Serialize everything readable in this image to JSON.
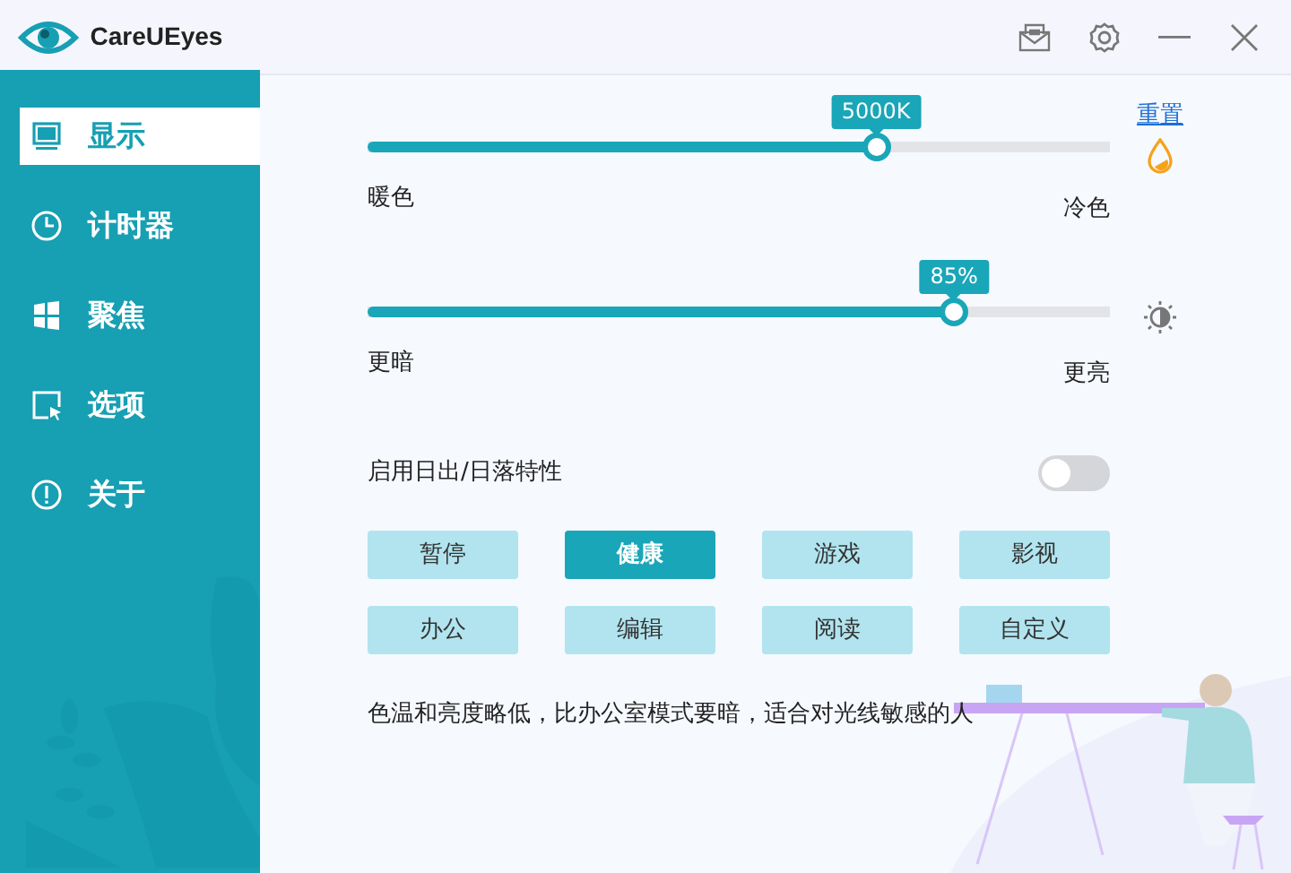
{
  "window": {
    "title": "CareUEyes"
  },
  "title_bar_buttons": [
    {
      "kind": "mail"
    },
    {
      "kind": "settings"
    },
    {
      "kind": "minimize"
    },
    {
      "kind": "close"
    }
  ],
  "sidebar": {
    "items": [
      {
        "label": "显示",
        "kind": "monitor",
        "selected": true
      },
      {
        "label": "计时器",
        "kind": "clock",
        "selected": false
      },
      {
        "label": "聚焦",
        "kind": "windows",
        "selected": false
      },
      {
        "label": "选项",
        "kind": "cursor",
        "selected": false
      },
      {
        "label": "关于",
        "kind": "info",
        "selected": false
      }
    ]
  },
  "sliders": [
    {
      "kind": "temperature",
      "tooltip": "5000K",
      "level": 0.685,
      "min_label": "暖色",
      "max_label": "冷色",
      "link": "重置"
    },
    {
      "kind": "brightness",
      "tooltip": "85%",
      "level": 0.79,
      "min_label": "更暗",
      "max_label": "更亮"
    }
  ],
  "sunrise_toggle": {
    "label": "启用日出/日落特性",
    "on": false
  },
  "presets": [
    {
      "label": "暂停",
      "selected": false
    },
    {
      "label": "健康",
      "selected": true
    },
    {
      "label": "游戏",
      "selected": false
    },
    {
      "label": "影视",
      "selected": false
    },
    {
      "label": "办公",
      "selected": false
    },
    {
      "label": "编辑",
      "selected": false
    },
    {
      "label": "阅读",
      "selected": false
    },
    {
      "label": "自定义",
      "selected": false
    }
  ],
  "description": "色温和亮度略低，比办公室模式要暗，适合对光线敏感的人"
}
